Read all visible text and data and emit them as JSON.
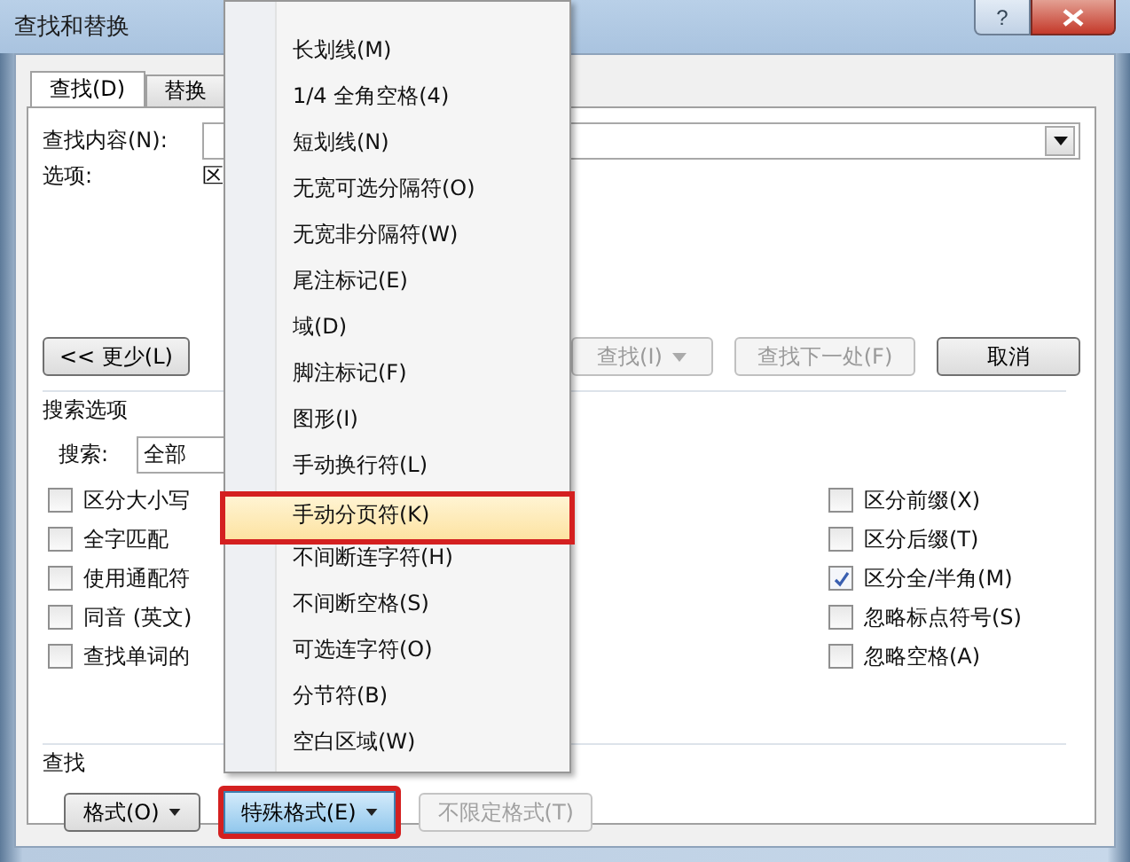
{
  "window": {
    "title": "查找和替换",
    "help": "?"
  },
  "tabs": [
    {
      "label": "查找(D)",
      "selected": true
    },
    {
      "label": "替换",
      "selected": false
    }
  ],
  "find_what": {
    "label": "查找内容(N):"
  },
  "options": {
    "label": "选项:",
    "value": "区"
  },
  "buttons": [
    {
      "label": "<< 更少(L)",
      "disabled": false,
      "dropdown": false
    },
    {
      "label": "查找(I)",
      "disabled": true,
      "dropdown": true
    },
    {
      "label": "查找下一处(F)",
      "disabled": true,
      "dropdown": false
    },
    {
      "label": "取消",
      "disabled": false,
      "dropdown": false
    }
  ],
  "search_options": {
    "title": "搜索选项",
    "search_label": "搜索:",
    "search_value": "全部",
    "left": [
      {
        "label": "区分大小写",
        "checked": false
      },
      {
        "label": "全字匹配",
        "checked": false
      },
      {
        "label": "使用通配符",
        "checked": false
      },
      {
        "label": "同音 (英文)",
        "checked": false
      },
      {
        "label": "查找单词的",
        "checked": false
      }
    ],
    "right": [
      {
        "label": "区分前缀(X)",
        "checked": false
      },
      {
        "label": "区分后缀(T)",
        "checked": false
      },
      {
        "label": "区分全/半角(M)",
        "checked": true
      },
      {
        "label": "忽略标点符号(S)",
        "checked": false
      },
      {
        "label": "忽略空格(A)",
        "checked": false
      }
    ]
  },
  "find_section": {
    "title": "查找",
    "buttons": [
      {
        "label": "格式(O)",
        "dropdown": true,
        "disabled": false,
        "pressed": false
      },
      {
        "label": "特殊格式(E)",
        "dropdown": true,
        "disabled": false,
        "pressed": true
      },
      {
        "label": "不限定格式(T)",
        "dropdown": false,
        "disabled": true,
        "pressed": false
      }
    ]
  },
  "menu": {
    "items": [
      {
        "label": "长划线(M)",
        "selected": false
      },
      {
        "label": "1/4 全角空格(4)",
        "selected": false
      },
      {
        "label": "短划线(N)",
        "selected": false
      },
      {
        "label": "无宽可选分隔符(O)",
        "selected": false
      },
      {
        "label": "无宽非分隔符(W)",
        "selected": false
      },
      {
        "label": "尾注标记(E)",
        "selected": false
      },
      {
        "label": "域(D)",
        "selected": false
      },
      {
        "label": "脚注标记(F)",
        "selected": false
      },
      {
        "label": "图形(I)",
        "selected": false
      },
      {
        "label": "手动换行符(L)",
        "selected": false
      },
      {
        "label": "手动分页符(K)",
        "selected": true
      },
      {
        "label": "不间断连字符(H)",
        "selected": false
      },
      {
        "label": "不间断空格(S)",
        "selected": false
      },
      {
        "label": "可选连字符(O)",
        "selected": false
      },
      {
        "label": "分节符(B)",
        "selected": false
      },
      {
        "label": "空白区域(W)",
        "selected": false
      }
    ]
  }
}
